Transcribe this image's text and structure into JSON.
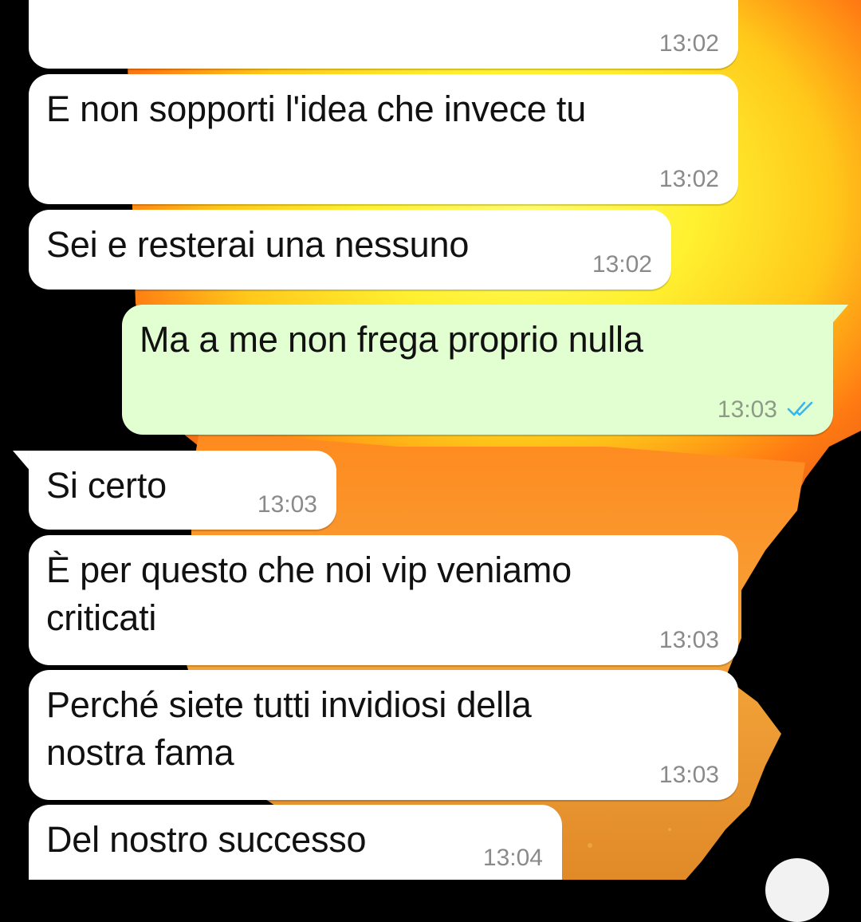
{
  "messages": [
    {
      "text": "",
      "time": "13:02",
      "direction": "in"
    },
    {
      "text": "E non sopporti l'idea che invece tu",
      "time": "13:02",
      "direction": "in"
    },
    {
      "text": "Sei e resterai una nessuno",
      "time": "13:02",
      "direction": "in"
    },
    {
      "text": "Ma a me non frega proprio nulla",
      "time": "13:03",
      "direction": "out",
      "status": "read-ticks-icon"
    },
    {
      "text": "Si certo",
      "time": "13:03",
      "direction": "in"
    },
    {
      "text": "È per questo che noi vip veniamo\ncriticati",
      "time": "13:03",
      "direction": "in"
    },
    {
      "text": "Perché siete tutti invidiosi della\nnostra fama",
      "time": "13:03",
      "direction": "in"
    },
    {
      "text": "Del nostro successo",
      "time": "13:04",
      "direction": "in"
    }
  ],
  "colors": {
    "incoming_bubble": "#ffffff",
    "outgoing_bubble": "#e2ffd2",
    "read_ticks": "#34b7f1",
    "wallpaper_background": "#000000",
    "wallpaper_sun": "#ffe400"
  },
  "scroll_button_icon": "scroll-down-icon"
}
